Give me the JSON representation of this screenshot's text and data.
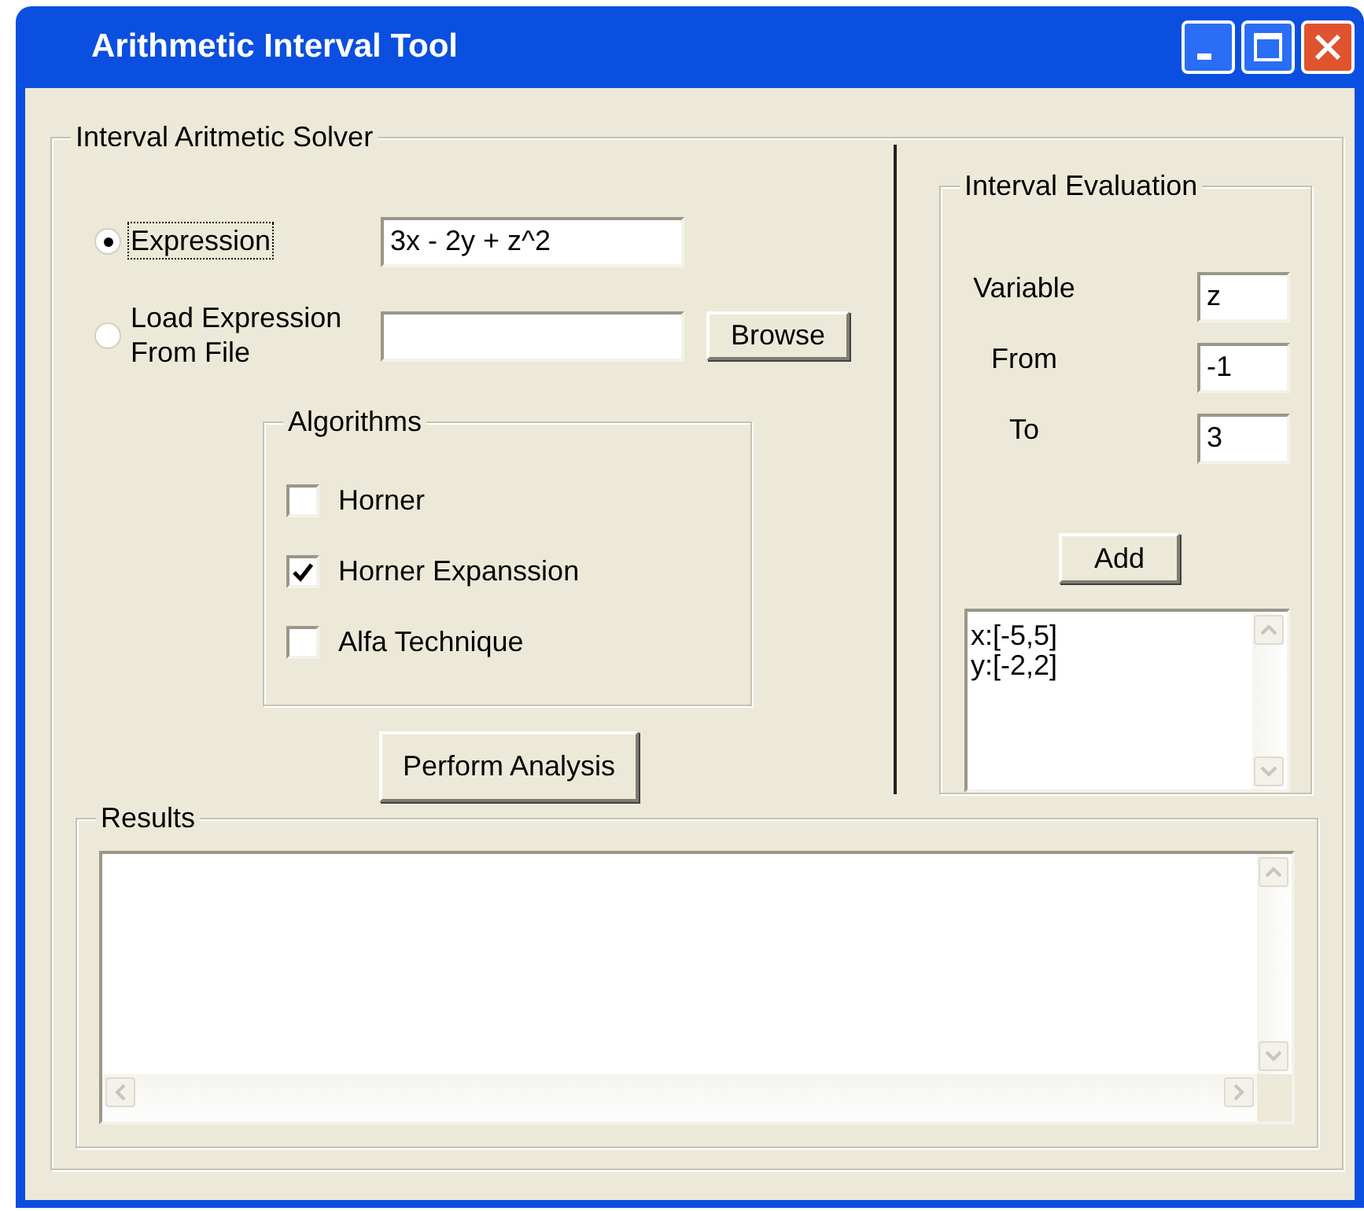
{
  "window": {
    "title": "Arithmetic Interval Tool"
  },
  "solver": {
    "title": "Interval Aritmetic Solver",
    "sources": [
      {
        "label": "Expression",
        "selected": true,
        "focused": true,
        "value": "3x - 2y + z^2"
      },
      {
        "label": "Load Expression\nFrom File",
        "selected": false,
        "focused": false,
        "button": "Browse"
      }
    ],
    "algorithms": {
      "title": "Algorithms",
      "items": [
        {
          "label": "Horner",
          "checked": false
        },
        {
          "label": "Horner Expanssion",
          "checked": true
        },
        {
          "label": "Alfa Technique",
          "checked": false
        }
      ]
    },
    "perform_button": "Perform Analysis"
  },
  "evaluation": {
    "title": "Interval Evaluation",
    "fields": [
      {
        "label": "Variable",
        "value": "z"
      },
      {
        "label": "From",
        "value": "-1"
      },
      {
        "label": "To",
        "value": "3"
      }
    ],
    "add_button": "Add",
    "intervals": [
      "x:[-5,5]",
      "y:[-2,2]"
    ]
  },
  "results": {
    "title": "Results"
  }
}
